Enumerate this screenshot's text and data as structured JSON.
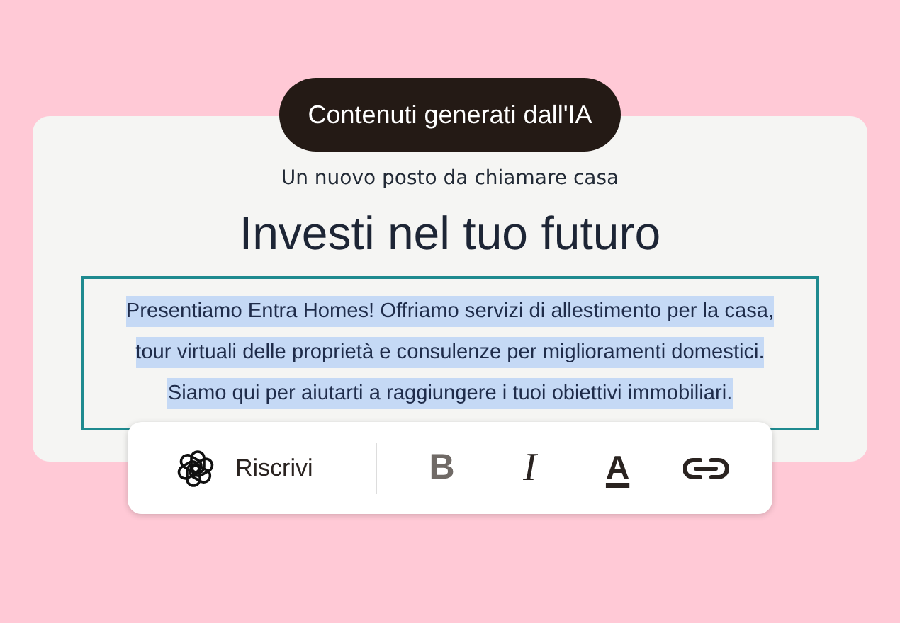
{
  "badge": "Contenuti generati dall'IA",
  "card": {
    "subtitle": "Un nuovo posto da chiamare casa",
    "title": "Investi nel tuo futuro",
    "body": "Presentiamo Entra Homes! Offriamo servizi di allestimento per la casa, tour virtuali delle proprietà e consulenze per miglioramenti domestici. Siamo qui per aiutarti a raggiungere i tuoi obiettivi immobiliari.",
    "body_selected": true
  },
  "toolbar": {
    "rewrite": "Riscrivi",
    "tools": [
      {
        "kind": "bold",
        "label": "B"
      },
      {
        "kind": "italic",
        "label": "I"
      },
      {
        "kind": "color",
        "label": "A"
      },
      {
        "kind": "link"
      }
    ]
  }
}
